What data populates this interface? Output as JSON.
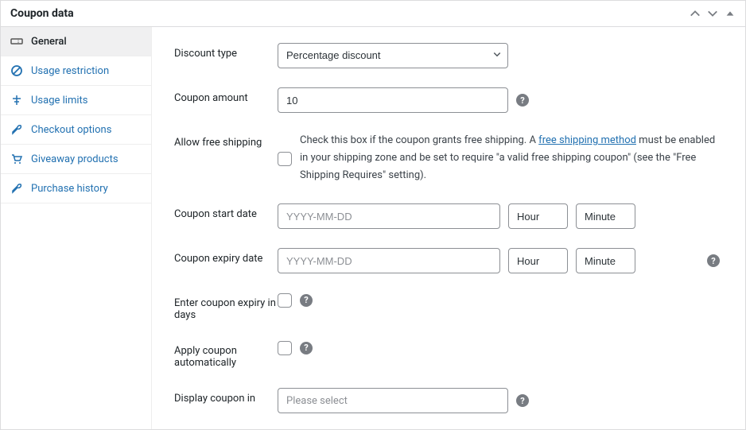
{
  "panel": {
    "title": "Coupon data"
  },
  "sidebar": {
    "items": [
      {
        "label": "General",
        "icon": "ticket-icon",
        "active": true
      },
      {
        "label": "Usage restriction",
        "icon": "ban-icon",
        "active": false
      },
      {
        "label": "Usage limits",
        "icon": "limits-icon",
        "active": false
      },
      {
        "label": "Checkout options",
        "icon": "wrench-icon",
        "active": false
      },
      {
        "label": "Giveaway products",
        "icon": "cart-icon",
        "active": false
      },
      {
        "label": "Purchase history",
        "icon": "wrench-icon",
        "active": false
      }
    ]
  },
  "form": {
    "discount_type": {
      "label": "Discount type",
      "value": "Percentage discount"
    },
    "coupon_amount": {
      "label": "Coupon amount",
      "value": "10"
    },
    "free_shipping": {
      "label": "Allow free shipping",
      "desc_pre": "Check this box if the coupon grants free shipping. A ",
      "link_text": "free shipping method",
      "desc_post": " must be enabled in your shipping zone and be set to require \"a valid free shipping coupon\" (see the \"Free Shipping Requires\" setting)."
    },
    "start_date": {
      "label": "Coupon start date",
      "date_ph": "YYYY-MM-DD",
      "hour_ph": "Hour",
      "minute_ph": "Minute"
    },
    "expiry_date": {
      "label": "Coupon expiry date",
      "date_ph": "YYYY-MM-DD",
      "hour_ph": "Hour",
      "minute_ph": "Minute"
    },
    "expiry_in_days": {
      "label": "Enter coupon expiry in days"
    },
    "auto_apply": {
      "label": "Apply coupon automatically"
    },
    "display_in": {
      "label": "Display coupon in",
      "placeholder": "Please select"
    }
  },
  "icons": {
    "help": "?"
  }
}
